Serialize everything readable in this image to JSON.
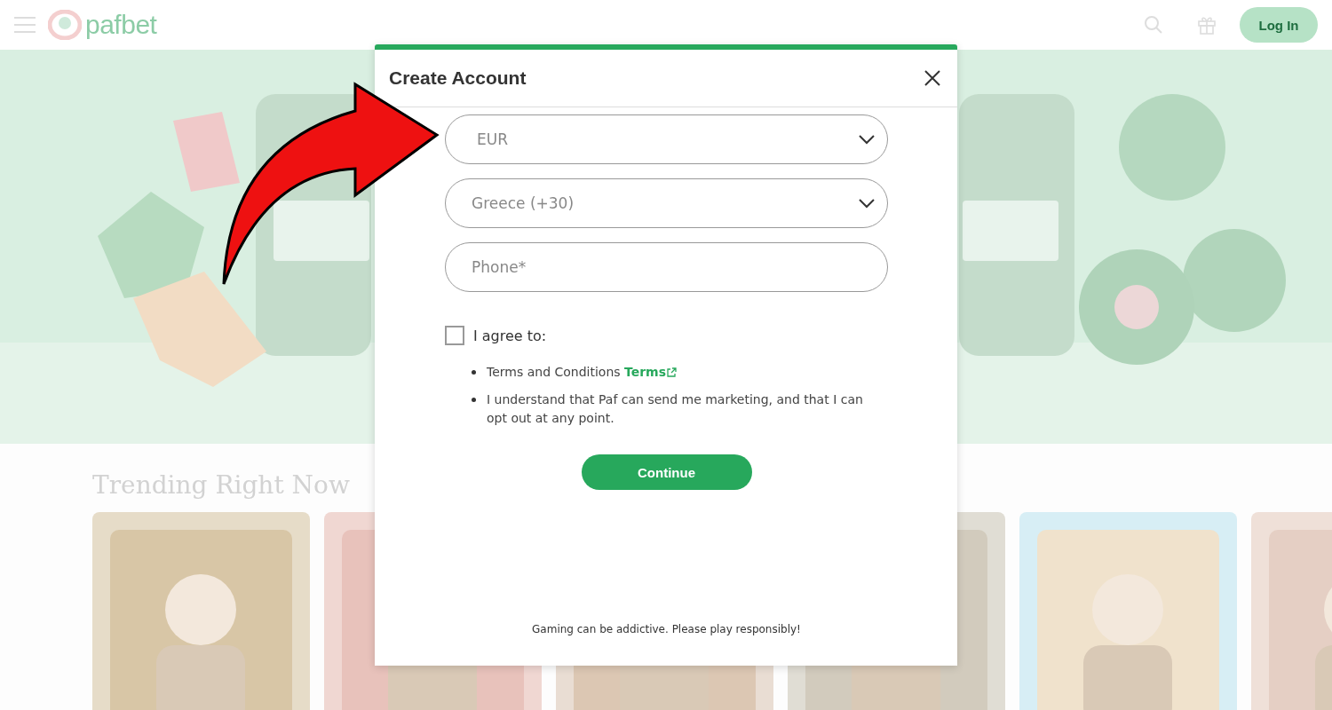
{
  "header": {
    "logo": "pafbet",
    "login_button": "Log In"
  },
  "section": {
    "title": "Trending Right Now"
  },
  "modal": {
    "title": "Create Account",
    "fields": [
      {
        "kind": "select",
        "value": "EUR"
      },
      {
        "kind": "select",
        "value": "Greece (+30)"
      },
      {
        "kind": "input",
        "placeholder": "Phone*"
      }
    ],
    "agree": {
      "label": "I agree to:",
      "checked": false
    },
    "terms": [
      {
        "text": "Terms and Conditions",
        "link": "Terms"
      },
      {
        "text": "I understand that Paf can send me marketing, and that I can opt out at any point."
      }
    ],
    "continue_button": "Continue",
    "footer": "Gaming can be addictive. Please play responsibly!"
  }
}
